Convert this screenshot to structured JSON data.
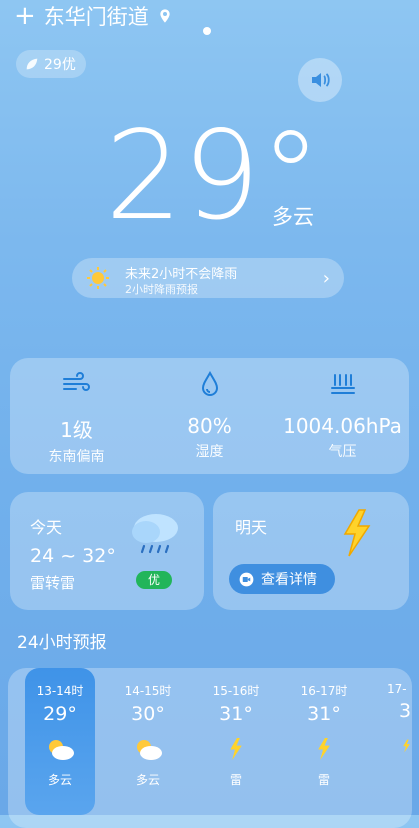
{
  "header": {
    "plus": "+",
    "location": "东华门街道"
  },
  "aqi": {
    "label": "29优"
  },
  "current": {
    "temperature": "29°",
    "condition": "多云"
  },
  "rain": {
    "title": "未来2小时不会降雨",
    "subtitle": "2小时降雨预报"
  },
  "metrics": [
    {
      "value": "1级",
      "label": "东南偏南",
      "icon": "wind-icon"
    },
    {
      "value": "80%",
      "label": "湿度",
      "icon": "humidity-icon"
    },
    {
      "value": "1004.06hPa",
      "label": "气压",
      "icon": "pressure-icon"
    }
  ],
  "today": {
    "title": "今天",
    "range": "24 ~ 32°",
    "condition": "雷转雷",
    "aqi_badge": "优"
  },
  "tomorrow": {
    "title": "明天",
    "detail_button": "查看详情"
  },
  "hourly": {
    "title": "24小时预报",
    "items": [
      {
        "time": "13-14时",
        "temp": "29°",
        "icon": "partly-cloudy-icon",
        "cond": "多云"
      },
      {
        "time": "14-15时",
        "temp": "30°",
        "icon": "partly-cloudy-icon",
        "cond": "多云"
      },
      {
        "time": "15-16时",
        "temp": "31°",
        "icon": "thunder-icon",
        "cond": "雷"
      },
      {
        "time": "16-17时",
        "temp": "31°",
        "icon": "thunder-icon",
        "cond": "雷"
      },
      {
        "time": "17-",
        "temp": "3",
        "icon": "thunder-icon",
        "cond": ""
      }
    ]
  },
  "colors": {
    "accent_badge": "#22b55a",
    "active_hour": "#3f93e8",
    "thunder": "#ffd32a"
  }
}
